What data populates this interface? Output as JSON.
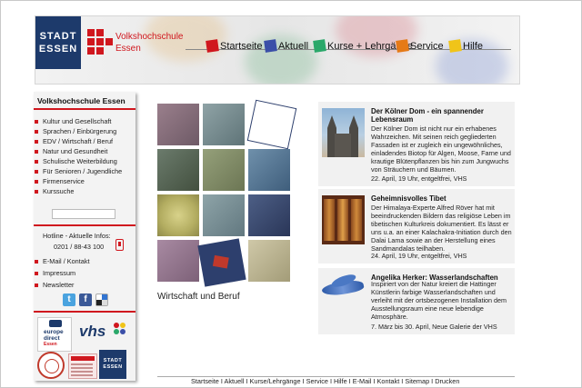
{
  "header": {
    "logo_line1": "STADT",
    "logo_line2": "ESSEN",
    "vhs_name_line1": "Volkshochschule",
    "vhs_name_line2": "Essen",
    "nav": [
      {
        "label": "Startseite",
        "color": "#d0171e"
      },
      {
        "label": "Aktuell",
        "color": "#3b4fa8"
      },
      {
        "label": "Kurse + Lehrgänge",
        "color": "#2aa86a"
      },
      {
        "label": "Service",
        "color": "#e57a17"
      },
      {
        "label": "Hilfe",
        "color": "#f0c419"
      }
    ]
  },
  "sidebar": {
    "title": "Volkshochschule Essen",
    "items": [
      "Kultur und Gesellschaft",
      "Sprachen / Einbürgerung",
      "EDV / Wirtschaft / Beruf",
      "Natur und Gesundheit",
      "Schulische Weiterbildung",
      "Für Senioren / Jugendliche",
      "Firmenservice",
      "Kurssuche"
    ],
    "hotline_label": "Hotline - Aktuelle Infos:",
    "hotline_number": "0201 / 88-43 100",
    "links": [
      "E-Mail / Kontakt",
      "Impressum",
      "Newsletter"
    ],
    "social": [
      {
        "icon": "twitter-icon",
        "glyph": "t",
        "color": "#4aa3df"
      },
      {
        "icon": "facebook-icon",
        "glyph": "f",
        "color": "#3b5998"
      },
      {
        "icon": "delicious-icon",
        "glyph": "",
        "color": "#3274d1"
      }
    ],
    "eu_text_line1": "europe",
    "eu_text_line2": "direct",
    "eu_text_line3": "Essen",
    "vhs_logo": "vhs",
    "stadt_small_line1": "STADT",
    "stadt_small_line2": "ESSEN"
  },
  "tiles": {
    "caption": "Wirtschaft und Beruf",
    "colors": [
      "#8a6f7a",
      "#7b8f93",
      "#ffffff",
      "#5c6b5e",
      "#7f8b6a",
      "#5d7a95",
      "#b8b26a",
      "#7a8f95",
      "#3b4e73",
      "#9a7f96",
      "#2d3f6d",
      "#b9b290"
    ]
  },
  "cards": [
    {
      "title": "Der Kölner Dom - ein spannender Lebensraum",
      "text": "Der Kölner Dom ist nicht nur ein erhabenes Wahrzeichen. Mit seinen reich gegliederten Fassaden ist er zugleich ein ungewöhnliches, einladendes Biotop für Algen, Moose, Farne und krautige Blütenpflanzen bis hin zum Jungwuchs von Sträuchern und Bäumen.",
      "date": "22. April, 19 Uhr, entgeltfrei, VHS",
      "image": "cathedral-image"
    },
    {
      "title": "Geheimnisvolles Tibet",
      "text": "Der Himalaya-Experte Alfred Röver hat mit beeindruckenden Bildern das religiöse Leben im tibetischen Kulturkreis dokumentiert. Es lässt er uns u.a. an einer Kalachakra-Initiation durch den Dalai Lama sowie an der Herstellung eines Sandmandalas teilhaben.",
      "date": "24. April, 19 Uhr, entgeltfrei, VHS",
      "image": "prayer-wheels-image"
    },
    {
      "title": "Angelika Herker: Wasserlandschaften",
      "text": "Inspiriert von der Natur kreiert die Hattinger Künstlerin farbige Wasserlandschaften und verleiht mit der ortsbezogenen Installation dem Ausstellungsraum eine neue lebendige Atmosphäre.",
      "date": "7. März bis 30. April, Neue Galerie der VHS",
      "image": "water-art-image"
    }
  ],
  "footer": {
    "links": [
      "Startseite",
      "Aktuell",
      "Kurse/Lehrgänge",
      "Service",
      "Hilfe",
      "E-Mail",
      "Kontakt",
      "Sitemap",
      "Drucken"
    ],
    "separator": " I "
  }
}
